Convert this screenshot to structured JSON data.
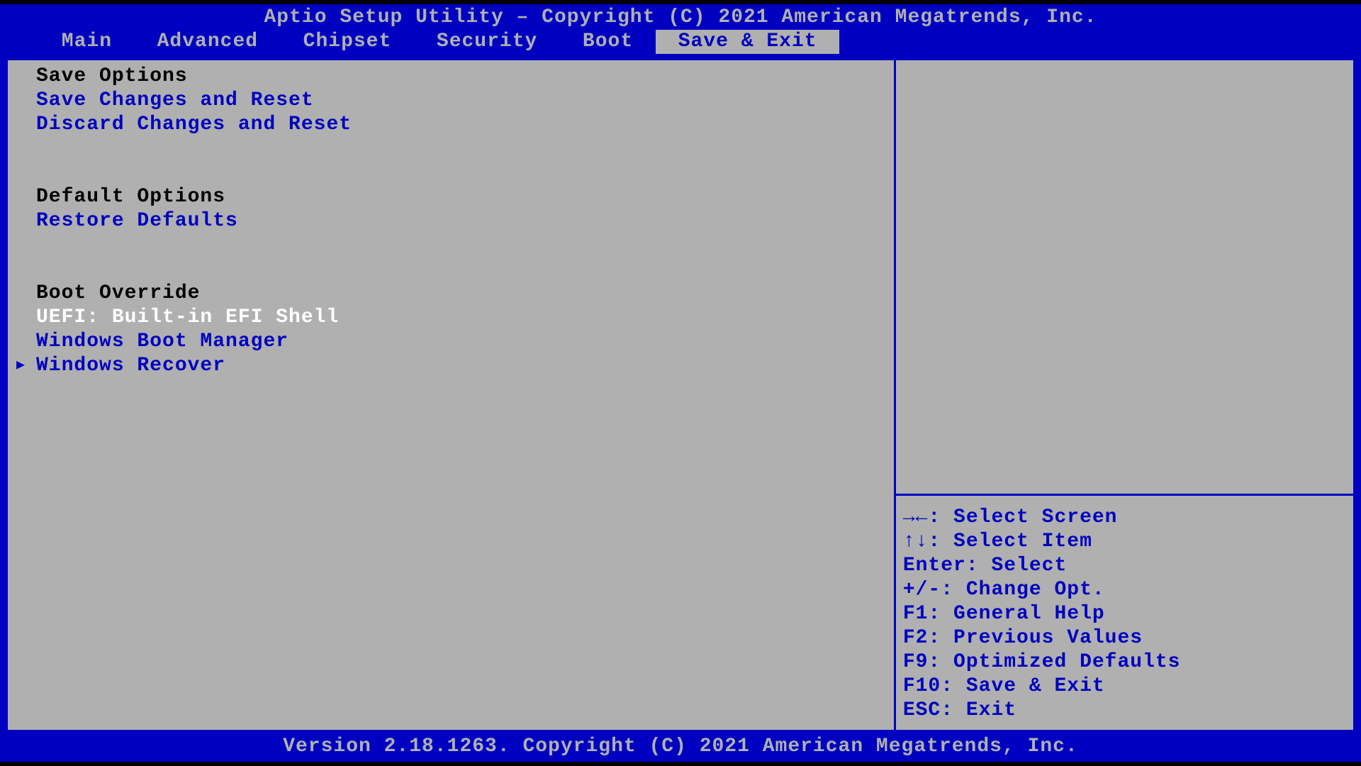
{
  "header": {
    "title": "Aptio Setup Utility – Copyright (C) 2021 American Megatrends, Inc.",
    "tabs": [
      "Main",
      "Advanced",
      "Chipset",
      "Security",
      "Boot",
      "Save & Exit"
    ],
    "active_tab": 5
  },
  "left_panel": {
    "groups": [
      {
        "heading": "Save Options",
        "items": [
          {
            "label": "Save Changes and Reset",
            "selected": false,
            "marker": false
          },
          {
            "label": "Discard Changes and Reset",
            "selected": false,
            "marker": false
          }
        ]
      },
      {
        "heading": "Default Options",
        "items": [
          {
            "label": "Restore Defaults",
            "selected": false,
            "marker": false
          }
        ]
      },
      {
        "heading": "Boot Override",
        "items": [
          {
            "label": "UEFI: Built-in EFI Shell",
            "selected": true,
            "marker": false
          },
          {
            "label": "Windows Boot Manager",
            "selected": false,
            "marker": false
          },
          {
            "label": "Windows Recover",
            "selected": false,
            "marker": true
          }
        ]
      }
    ]
  },
  "help": {
    "lines": [
      "→←: Select Screen",
      "↑↓: Select Item",
      "Enter: Select",
      "+/-: Change Opt.",
      "F1: General Help",
      "F2: Previous Values",
      "F9: Optimized Defaults",
      "F10: Save & Exit",
      "ESC: Exit"
    ]
  },
  "footer": {
    "text": "Version 2.18.1263. Copyright (C) 2021 American Megatrends, Inc."
  }
}
